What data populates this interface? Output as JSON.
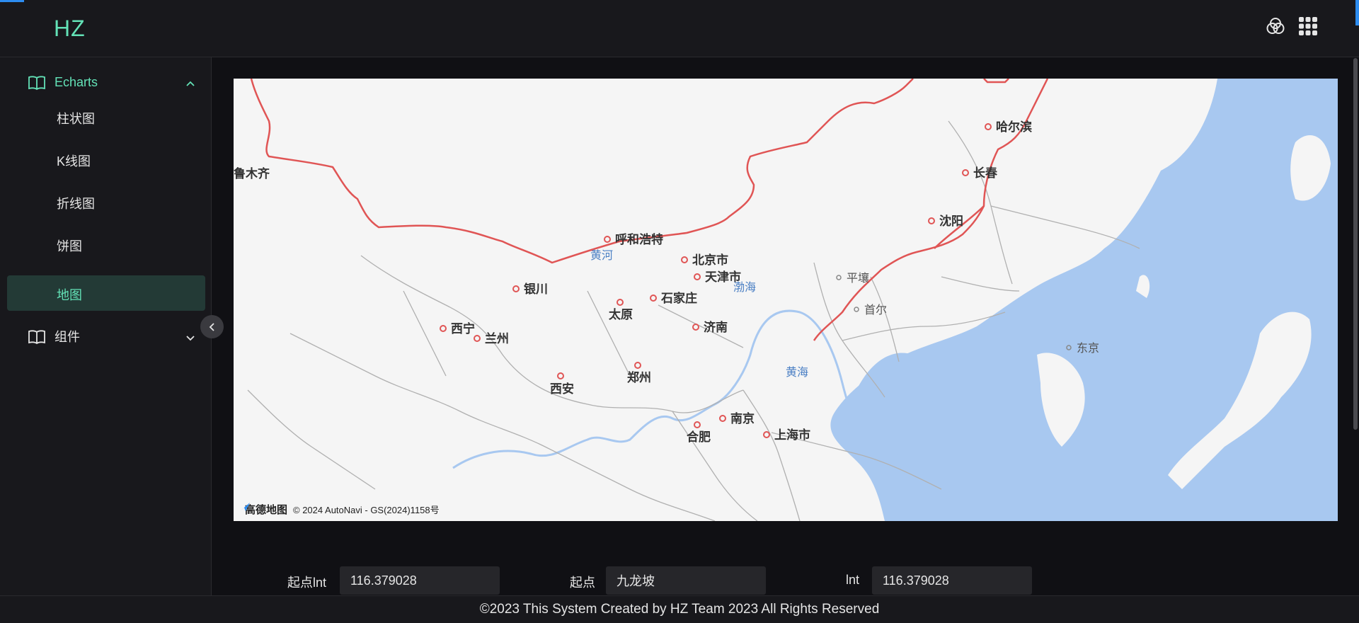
{
  "app": {
    "logo": "HZ"
  },
  "header": {
    "icons": [
      "theme-icon",
      "apps-grid-icon"
    ]
  },
  "sidebar": {
    "groups": [
      {
        "label": "Echarts",
        "expanded": true,
        "items": [
          "柱状图",
          "K线图",
          "折线图",
          "饼图",
          "地图"
        ],
        "active": "地图"
      },
      {
        "label": "组件",
        "expanded": false
      }
    ]
  },
  "map": {
    "cities": [
      "哈尔滨",
      "长春",
      "沈阳",
      "呼和浩特",
      "北京市",
      "天津市",
      "银川",
      "石家庄",
      "太原",
      "济南",
      "西宁",
      "兰州",
      "郑州",
      "西安",
      "南京",
      "合肥",
      "上海市",
      "平壤",
      "首尔",
      "东京",
      "鲁木齐"
    ],
    "seas": [
      "黄河",
      "渤海",
      "黄海"
    ],
    "attribution_brand": "高德地图",
    "attribution": "© 2024 AutoNavi - GS(2024)1158号"
  },
  "form": {
    "start_lng_label": "起点lnt",
    "start_lng_value": "116.379028",
    "start_label": "起点",
    "start_value": "九龙坡",
    "lnt_label": "lnt",
    "lnt_value": "116.379028"
  },
  "footer": {
    "text": "©2023 This System Created by HZ Team 2023 All Rights Reserved"
  },
  "colors": {
    "accent": "#63e2b7",
    "active_bg": "#233a36",
    "border_red": "#e05555",
    "water": "#a8c8f0"
  }
}
